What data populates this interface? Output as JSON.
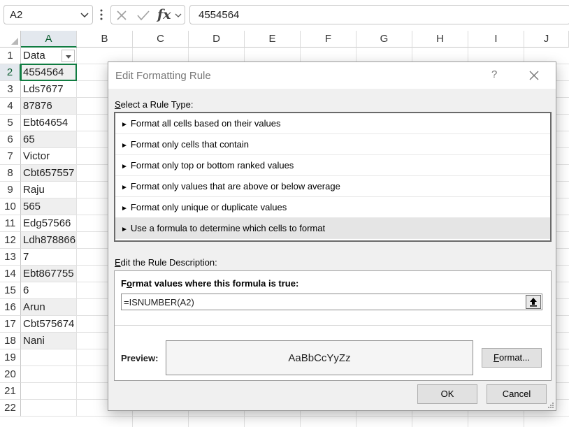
{
  "formula_bar": {
    "name_box": "A2",
    "formula": "4554564",
    "fx_label": "fx",
    "icons": [
      "chevron-down-icon",
      "more-options-icon",
      "cancel-x-icon",
      "enter-check-icon",
      "fx-icon"
    ]
  },
  "sheet": {
    "columns": [
      "A",
      "B",
      "C",
      "D",
      "E",
      "F",
      "G",
      "H",
      "I",
      "J"
    ],
    "rows": [
      "1",
      "2",
      "3",
      "4",
      "5",
      "6",
      "7",
      "8",
      "9",
      "10",
      "11",
      "12",
      "13",
      "14",
      "15",
      "16",
      "17",
      "18",
      "19",
      "20",
      "21",
      "22"
    ],
    "header_cell": "Data",
    "values": [
      "4554564",
      "Lds7677",
      "87876",
      "Ebt64654",
      "65",
      "Victor",
      "Cbt657557",
      "Raju",
      "565",
      "Edg57566",
      "Ldh878866",
      "7",
      "Ebt867755",
      "6",
      "Arun",
      "Cbt575674",
      "Nani"
    ],
    "shaded_rows": [
      2,
      4,
      6,
      8,
      10,
      12,
      14
    ],
    "active_cell": "A2"
  },
  "dialog": {
    "title": "Edit Formatting Rule",
    "help": "?",
    "select_label_key": "S",
    "select_label_rest": "elect a Rule Type:",
    "rule_types": [
      "Format all cells based on their values",
      "Format only cells that contain",
      "Format only top or bottom ranked values",
      "Format only values that are above or below average",
      "Format only unique or duplicate values",
      "Use a formula to determine which cells to format"
    ],
    "selected_rule_index": 5,
    "desc_label_key": "E",
    "desc_label_rest": "dit the Rule Description:",
    "formula_heading_key": "o",
    "formula_heading_pre": "F",
    "formula_heading_rest": "rmat values where this formula is true:",
    "formula_value": "=ISNUMBER(A2)",
    "preview_label": "Preview:",
    "preview_sample": "AaBbCcYyZz",
    "format_button_key": "F",
    "format_button_rest": "ormat...",
    "ok_label": "OK",
    "cancel_label": "Cancel",
    "colors": {
      "accent": "#107c41",
      "selected_row": "#e5e5e5",
      "dialog_bg": "#f0f0f0"
    }
  }
}
